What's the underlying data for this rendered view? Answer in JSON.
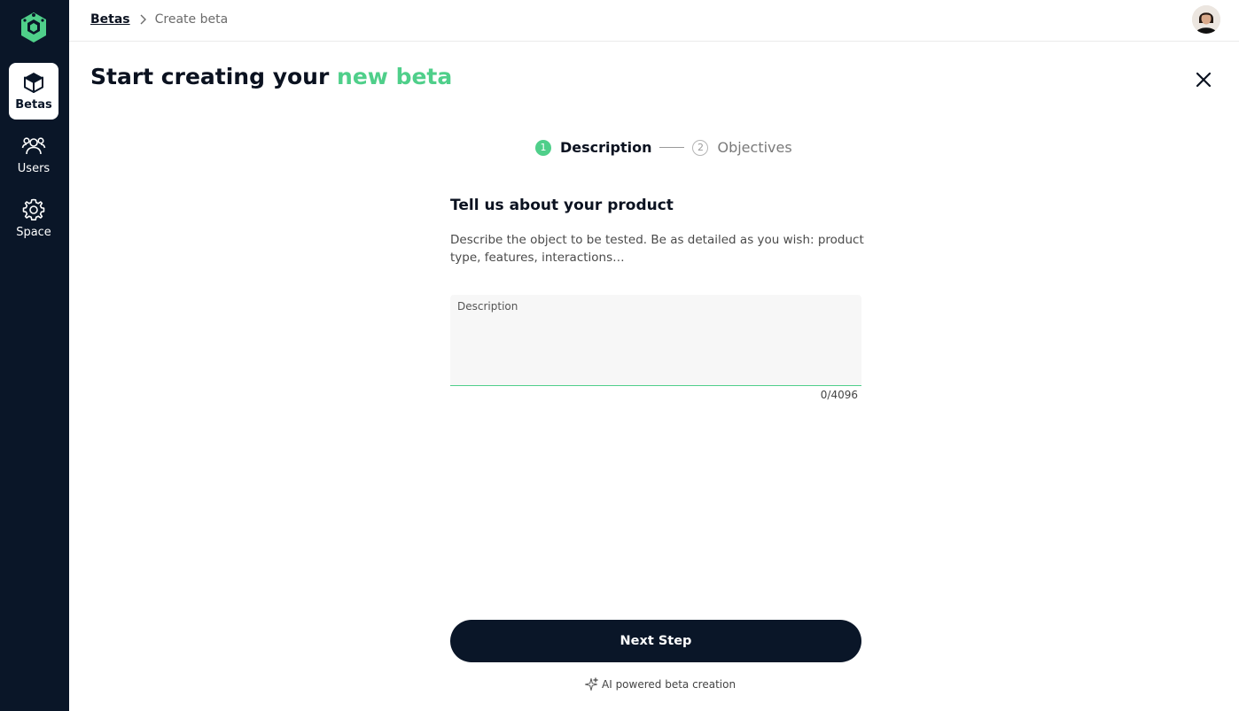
{
  "sidebar": {
    "logo_icon": "hexagon-logo-icon",
    "items": [
      {
        "label": "Betas",
        "icon": "cube-icon",
        "active": true
      },
      {
        "label": "Users",
        "icon": "users-icon",
        "active": false
      },
      {
        "label": "Space",
        "icon": "gear-icon",
        "active": false
      }
    ]
  },
  "header": {
    "breadcrumb": [
      {
        "label": "Betas"
      },
      {
        "label": "Create beta"
      }
    ]
  },
  "page": {
    "title_prefix": "Start creating your ",
    "title_accent": "new beta"
  },
  "stepper": {
    "steps": [
      {
        "number": "1",
        "label": "Description",
        "active": true
      },
      {
        "number": "2",
        "label": "Objectives",
        "active": false
      }
    ]
  },
  "form": {
    "heading": "Tell us about your product",
    "description": "Describe the object to be tested. Be as detailed as you wish: product type, features, interactions…",
    "field_label": "Description",
    "field_value": "",
    "char_count": "0/4096"
  },
  "actions": {
    "next_label": "Next Step",
    "ai_note": "AI powered beta creation"
  },
  "colors": {
    "sidebar_bg": "#0a1628",
    "accent": "#4fcf8a",
    "button_bg": "#0a1628"
  }
}
